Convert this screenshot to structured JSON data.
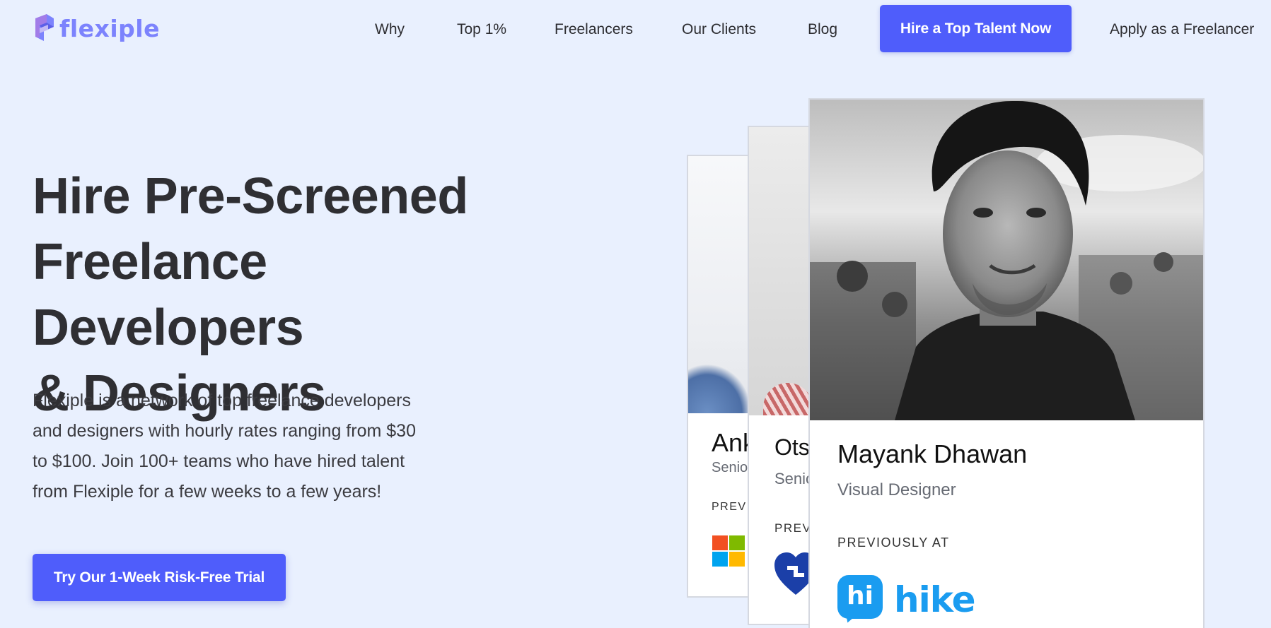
{
  "header": {
    "logo_text": "flexiple",
    "nav": [
      "Why",
      "Top 1%",
      "Freelancers",
      "Our Clients",
      "Blog"
    ],
    "hire_label": "Hire a Top Talent Now",
    "apply_label": "Apply as a Freelancer"
  },
  "hero": {
    "title_line1": "Hire Pre-Screened",
    "title_line2": "Freelance Developers",
    "title_line3": "& Designers",
    "desc_line1": "Flexiple is a network of top freelance developers",
    "desc_line2": "and designers with hourly rates ranging from $30",
    "desc_line3": "to $100. Join 100+ teams who have hired talent",
    "desc_line4": "from Flexiple for a few weeks to a few years!",
    "cta_label": "Try Our 1-Week Risk-Free Trial"
  },
  "cards": [
    {
      "name": "Anku",
      "role": "Senio",
      "prev": "PREVIO",
      "company_icon": "microsoft-logo-icon"
    },
    {
      "name": "Ots",
      "role": "Senic",
      "prev": "PREVI",
      "company_icon": "heart-logo-icon"
    },
    {
      "name": "Mayank Dhawan",
      "role": "Visual Designer",
      "prev": "PREVIOUSLY AT",
      "company_name": "hike",
      "company_badge": "hi",
      "company_icon": "hike-logo-icon"
    }
  ],
  "colors": {
    "background": "#e9f0fe",
    "accent": "#4f5dfb",
    "logo": "#7c83fd",
    "hike": "#1a9cf0"
  }
}
